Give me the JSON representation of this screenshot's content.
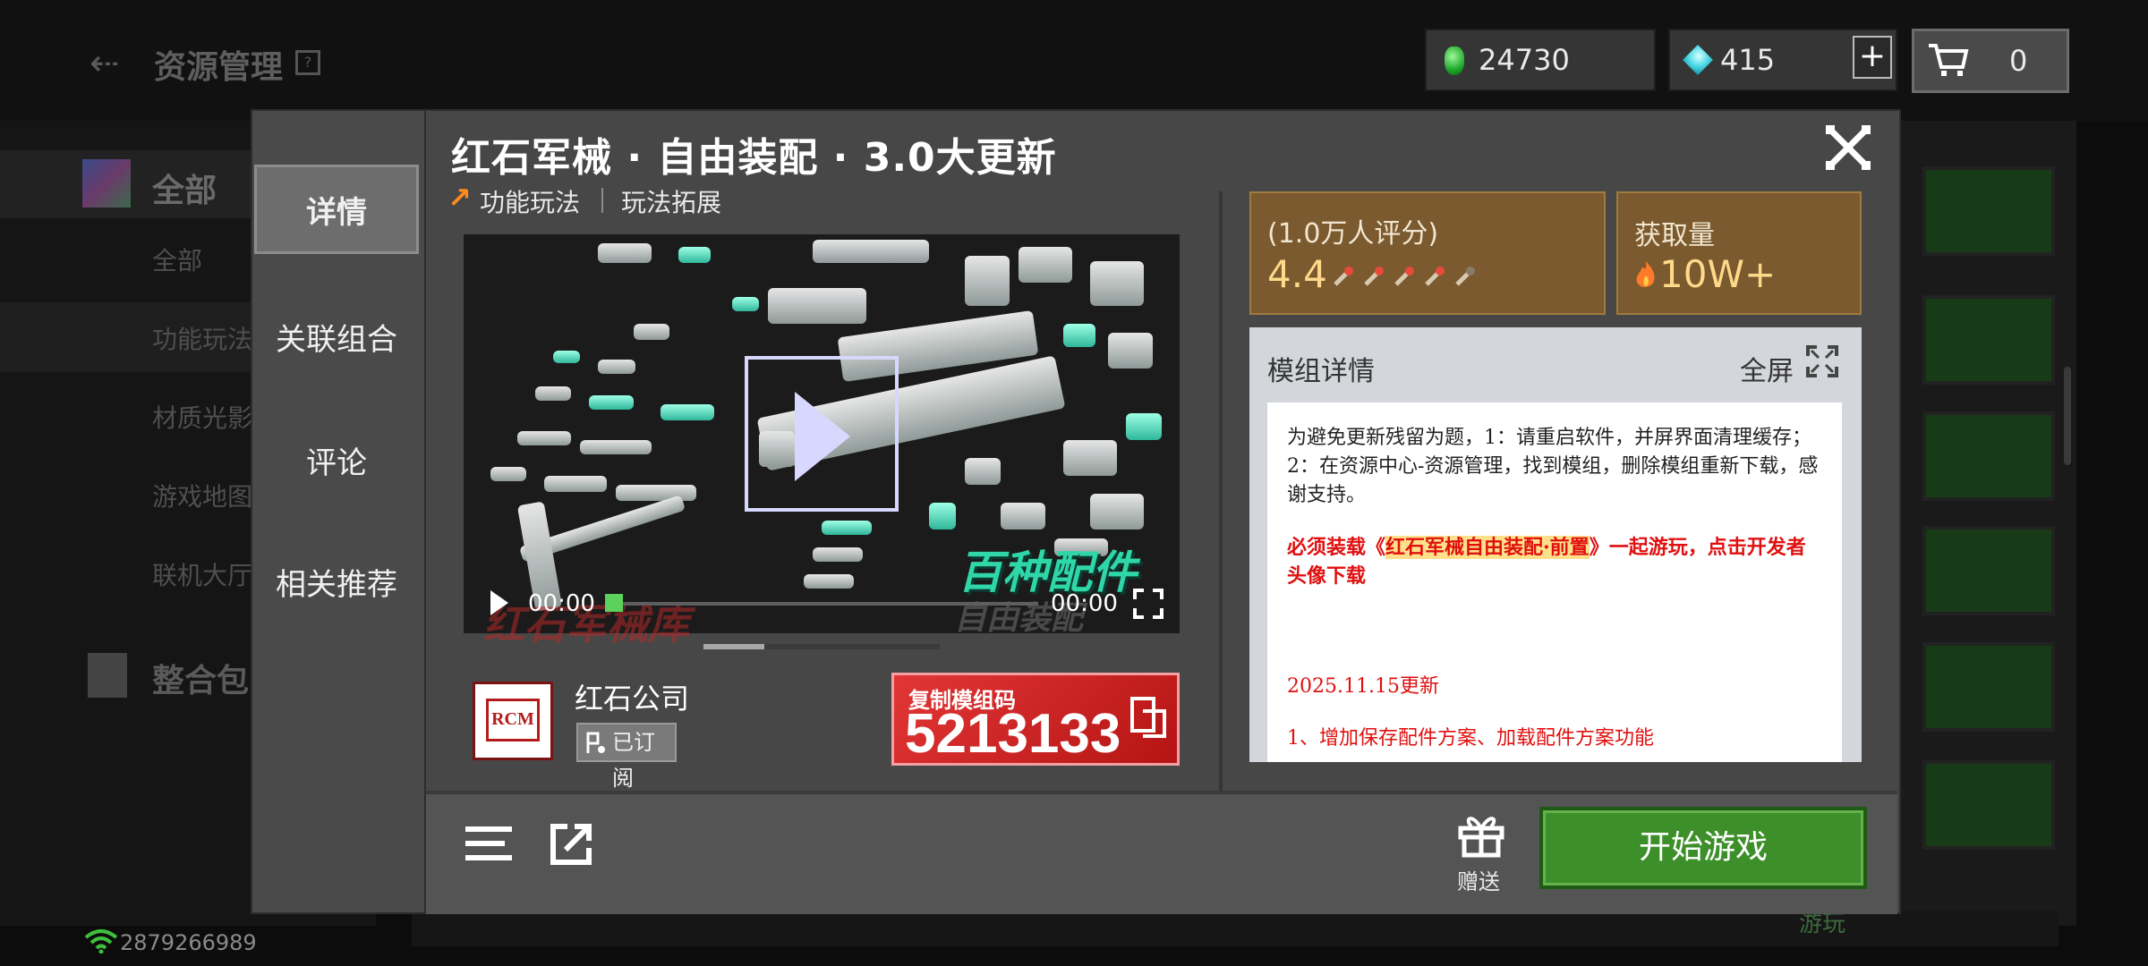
{
  "background": {
    "header_title": "资源管理",
    "categories": [
      "全部"
    ],
    "sub_items": [
      "全部",
      "功能玩法",
      "材质光影",
      "游戏地图",
      "联机大厅"
    ],
    "pack_label": "整合包",
    "bottom_right_label": "游玩",
    "network_id": "2879266989"
  },
  "currency": {
    "emerald": "24730",
    "diamond": "415",
    "plus": "+",
    "cart_count": "0"
  },
  "modal": {
    "tabs": [
      "详情",
      "关联组合",
      "评论",
      "相关推荐"
    ],
    "active_tab": 0,
    "title": "红石军械 · 自由装配 · 3.0大更新",
    "tags": [
      "功能玩法",
      "玩法拓展"
    ],
    "video": {
      "caption": "百种配件",
      "caption2": "自由装配",
      "watermark": "红石军械库",
      "time_current": "00:00",
      "time_total": "00:00"
    },
    "author": {
      "name": "红石公司",
      "logo_text": "RCM",
      "subscribed_label": "已订阅"
    },
    "mod_code": {
      "label": "复制模组码",
      "value": "5213133"
    },
    "rating": {
      "count_label": "(1.0万人评分)",
      "score": "4.4",
      "stars": 4.4
    },
    "downloads": {
      "label": "获取量",
      "value": "10W+"
    },
    "details": {
      "title": "模组详情",
      "fullscreen_label": "全屏",
      "para1": "为避免更新残留为题，1：请重启软件，并屏界面清理缓存；2：在资源中心-资源管理，找到模组，删除模组重新下载，感谢支持。",
      "para2_pre": "必须装载《",
      "para2_hl": "红石军械自由装配·前置",
      "para2_post": "》一起游玩，点击开发者头像下载",
      "date_line": "2025.11.15更新",
      "item1": "1、增加保存配件方案、加载配件方案功能"
    },
    "footer": {
      "gift_label": "赠送",
      "start_label": "开始游戏"
    }
  }
}
